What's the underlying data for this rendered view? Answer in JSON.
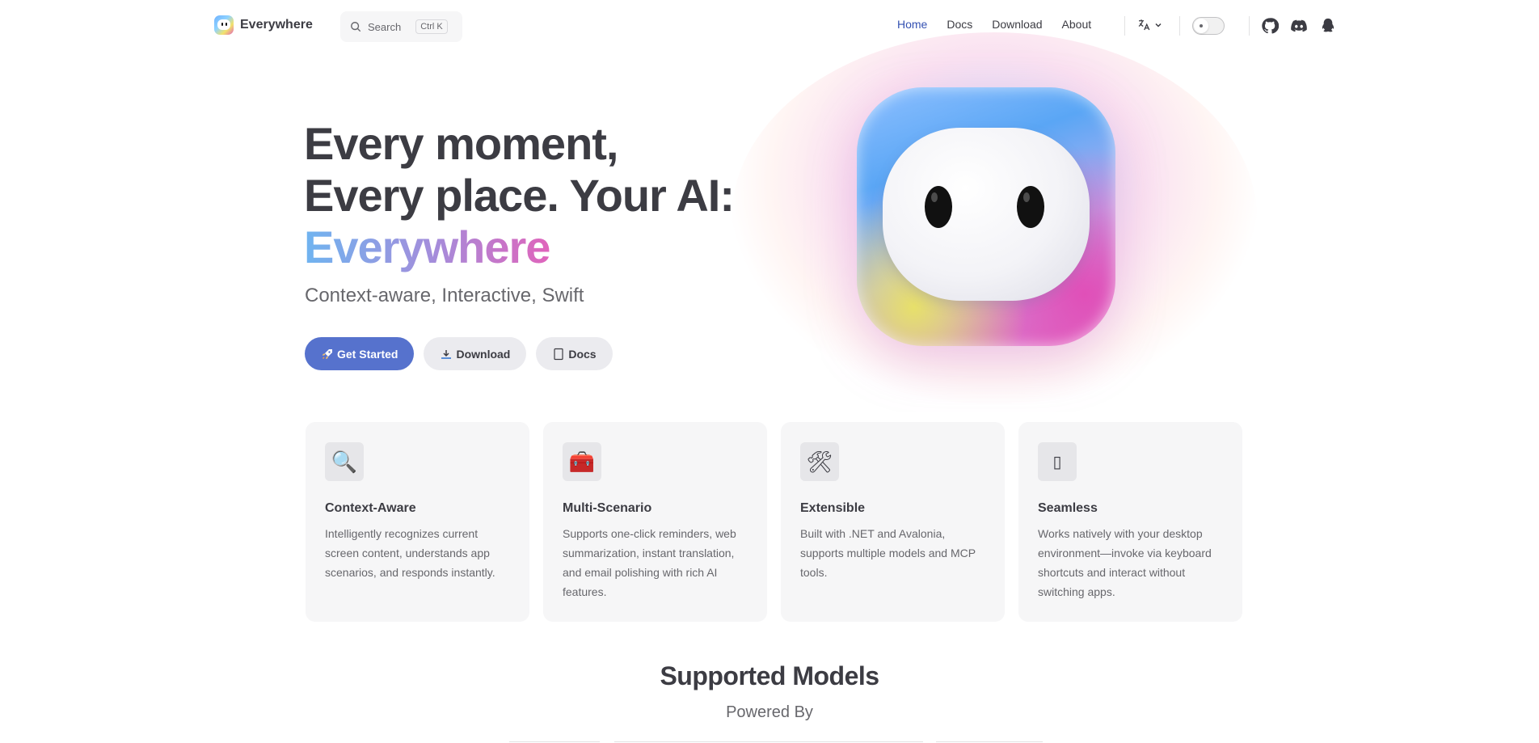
{
  "nav": {
    "brand": "Everywhere",
    "search": {
      "label": "Search",
      "kbd": "Ctrl K"
    },
    "links": [
      {
        "label": "Home",
        "active": true
      },
      {
        "label": "Docs",
        "active": false
      },
      {
        "label": "Download",
        "active": false
      },
      {
        "label": "About",
        "active": false
      }
    ],
    "icons": [
      "translate-icon",
      "theme-toggle",
      "github-icon",
      "discord-icon",
      "qq-icon"
    ]
  },
  "hero": {
    "line1": "Every moment,",
    "line2": "Every place. Your AI:",
    "line3": "Everywhere",
    "tagline": "Context-aware, Interactive, Swift",
    "buttons": {
      "get_started": "Get Started",
      "download": "Download",
      "docs": "Docs"
    }
  },
  "features": [
    {
      "icon": "magnifier-icon",
      "emoji": "🔍",
      "title": "Context-Aware",
      "desc": "Intelligently recognizes current screen content, understands app scenarios, and responds instantly."
    },
    {
      "icon": "toolbox-icon",
      "emoji": "🧰",
      "title": "Multi-Scenario",
      "desc": "Supports one-click reminders, web summarization, instant translation, and email polishing with rich AI features."
    },
    {
      "icon": "tools-icon",
      "emoji": "🛠",
      "title": "Extensible",
      "desc": "Built with .NET and Avalonia, supports multiple models and MCP tools."
    },
    {
      "icon": "device-icon",
      "emoji": "▯",
      "title": "Seamless",
      "desc": "Works natively with your desktop environment—invoke via keyboard shortcuts and interact without switching apps."
    }
  ],
  "models": {
    "title": "Supported Models",
    "subtitle": "Powered By"
  },
  "colors": {
    "accent": "#3451b2",
    "primary_button": "#5672cd",
    "card_bg": "#f6f6f7"
  }
}
